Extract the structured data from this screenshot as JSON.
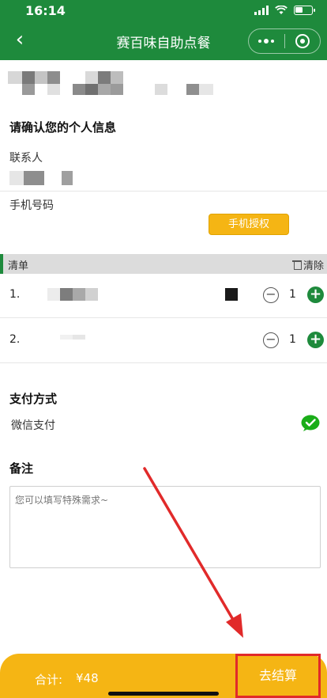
{
  "status": {
    "time": "16:14"
  },
  "nav": {
    "title": "赛百味自助点餐"
  },
  "contact": {
    "section_title": "请确认您的个人信息",
    "name_label": "联系人",
    "phone_label": "手机号码",
    "auth_button": "手机授权"
  },
  "list": {
    "title": "清单",
    "clear": "清除",
    "items": [
      {
        "index": "1.",
        "qty": "1"
      },
      {
        "index": "2.",
        "qty": "1"
      }
    ]
  },
  "payment": {
    "section_title": "支付方式",
    "method": "微信支付"
  },
  "remark": {
    "section_title": "备注",
    "placeholder": "您可以填写特殊需求~"
  },
  "footer": {
    "total_label": "合计:",
    "total_amount": "¥48",
    "checkout": "去结算"
  },
  "colors": {
    "brand_green": "#1e8a3c",
    "accent_yellow": "#f5b514",
    "highlight_red": "#e12a2a"
  },
  "icons": [
    "back-icon",
    "more-icon",
    "target-icon",
    "trash-icon",
    "minus-icon",
    "plus-icon",
    "wechat-pay-icon"
  ]
}
